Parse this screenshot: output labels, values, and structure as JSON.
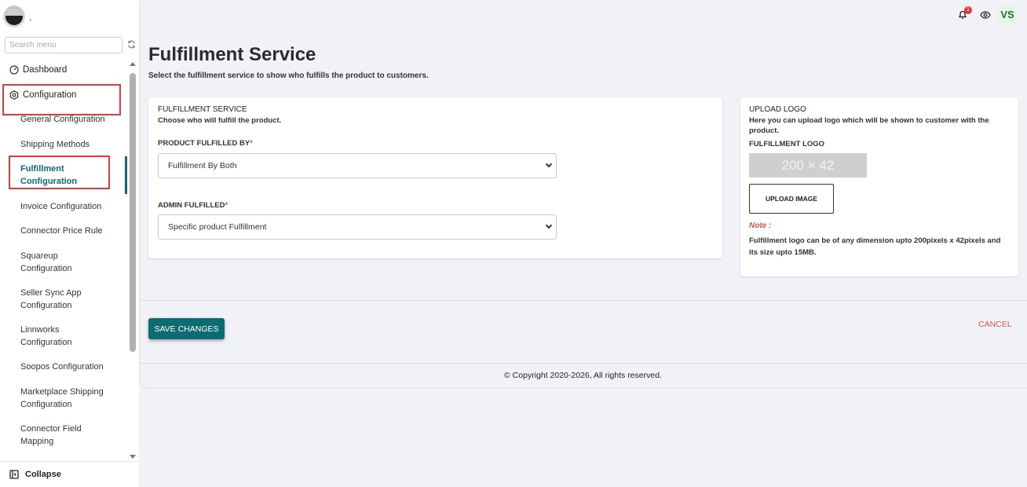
{
  "sidebar": {
    "logo_text": ".",
    "search_placeholder": "Search menu",
    "dashboard": "Dashboard",
    "configuration": "Configuration",
    "items": [
      "General Configuration",
      "Shipping Methods",
      "Fulfillment Configuration",
      "Invoice Configuration",
      "Connector Price Rule",
      "Squareup Configuration",
      "Seller Sync App Configuration",
      "Linnworks Configuration",
      "Soopos Configuration",
      "Marketplace Shipping Configuration",
      "Connector Field Mapping"
    ],
    "collapse": "Collapse"
  },
  "header": {
    "notification_count": "1",
    "avatar_initials": "VS"
  },
  "page": {
    "title": "Fulfillment Service",
    "subtitle": "Select the fulfillment service to show who fulfills the product to customers."
  },
  "fulfillment_card": {
    "title": "FULFILLMENT SERVICE",
    "description": "Choose who will fulfill the product.",
    "product_fulfilled_by_label": "PRODUCT FULFILLED BY",
    "product_fulfilled_by_value": "Fulfillment By Both",
    "admin_fulfilled_label": "ADMIN FULFILLED",
    "admin_fulfilled_value": "Specific product Fulfillment",
    "required_mark": "*"
  },
  "logo_card": {
    "title": "UPLOAD LOGO",
    "description": "Here you can upload logo which will be shown to customer with the product.",
    "logo_label": "FULFILLMENT LOGO",
    "placeholder_text": "200 × 42",
    "upload_button": "UPLOAD IMAGE",
    "note_label": "Note :",
    "note_text": "Fulfillment logo can be of any dimension upto 200pixels x 42pixels and its size upto 15MB."
  },
  "actions": {
    "save": "SAVE CHANGES",
    "cancel": "CANCEL"
  },
  "footer": {
    "copyright": "© Copyright 2020-2026, All rights reserved."
  },
  "colors": {
    "accent": "#0d6b72",
    "danger": "#d9534f",
    "highlight_box": "#e23b3b"
  }
}
